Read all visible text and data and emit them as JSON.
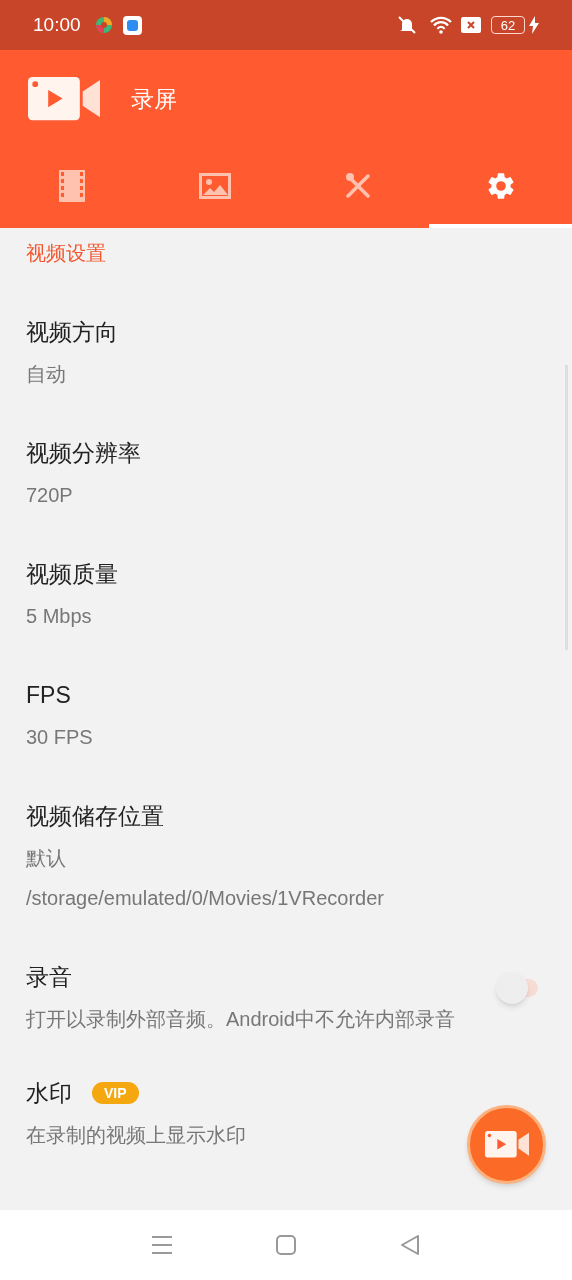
{
  "status_bar": {
    "time": "10:00",
    "battery": "62"
  },
  "app_bar": {
    "title": "录屏"
  },
  "tabs": [
    {
      "kind": "videos",
      "selected": false
    },
    {
      "kind": "images",
      "selected": false
    },
    {
      "kind": "tools",
      "selected": false
    },
    {
      "kind": "settings",
      "selected": true
    }
  ],
  "section": {
    "title": "视频设置"
  },
  "settings": [
    {
      "kind": "text",
      "title": "视频方向",
      "lines": [
        "自动"
      ]
    },
    {
      "kind": "text",
      "title": "视频分辨率",
      "lines": [
        "720P"
      ]
    },
    {
      "kind": "text",
      "title": "视频质量",
      "lines": [
        "5 Mbps"
      ]
    },
    {
      "kind": "text",
      "title": "FPS",
      "lines": [
        "30 FPS"
      ]
    },
    {
      "kind": "text",
      "title": "视频储存位置",
      "lines": [
        "默认",
        "/storage/emulated/0/Movies/1VRecorder"
      ]
    },
    {
      "kind": "toggle",
      "title": "录音",
      "description": "打开以录制外部音频。Android中不允许内部录音",
      "on": false
    },
    {
      "kind": "text",
      "title": "水印",
      "badge": "VIP",
      "lines": [
        "在录制的视频上显示水印"
      ]
    }
  ]
}
